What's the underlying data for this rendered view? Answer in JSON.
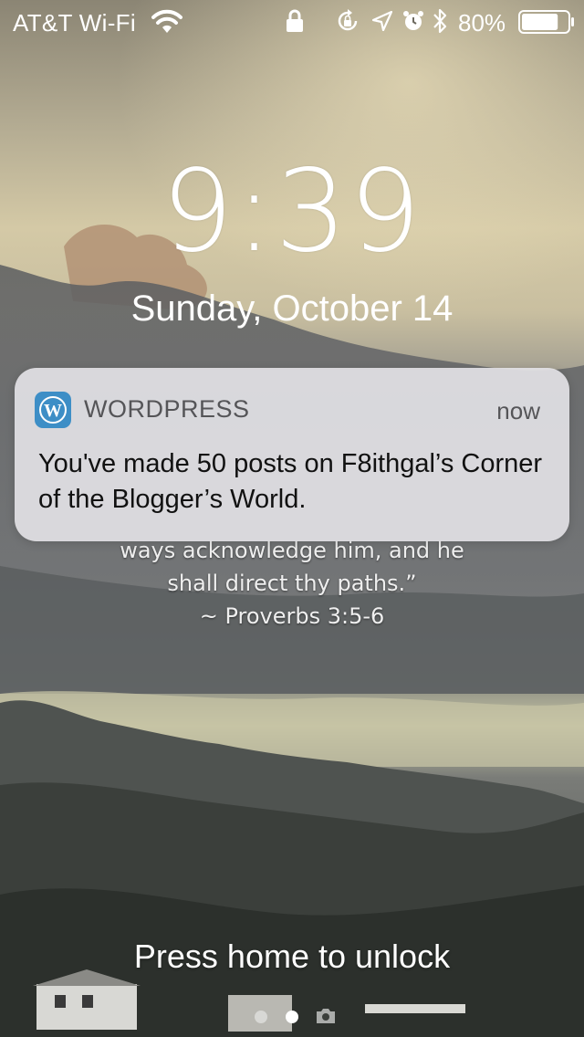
{
  "status_bar": {
    "carrier": "AT&T Wi-Fi",
    "battery_percent": "80%",
    "battery_level": 0.8,
    "icons": [
      "wifi-icon",
      "lock-icon",
      "rotation-lock-icon",
      "location-icon",
      "alarm-icon",
      "bluetooth-icon",
      "battery-icon"
    ]
  },
  "lock_screen": {
    "time": "9:39",
    "date": "Sunday, October 14"
  },
  "wallpaper_quote": {
    "lines": [
      "ways acknowledge him, and he",
      "shall direct thy paths.”",
      "~ Proverbs 3:5-6"
    ]
  },
  "notification": {
    "app_name": "WORDPRESS",
    "app_icon": "wordpress-icon",
    "time": "now",
    "message": "You've made 50 posts on F8ithgal’s Corner of the Blogger’s World.",
    "accent_color": "#3d8ec6"
  },
  "bottom": {
    "unlock_hint": "Press home to unlock",
    "page_indicator": [
      "widgets",
      "lock",
      "camera"
    ]
  }
}
